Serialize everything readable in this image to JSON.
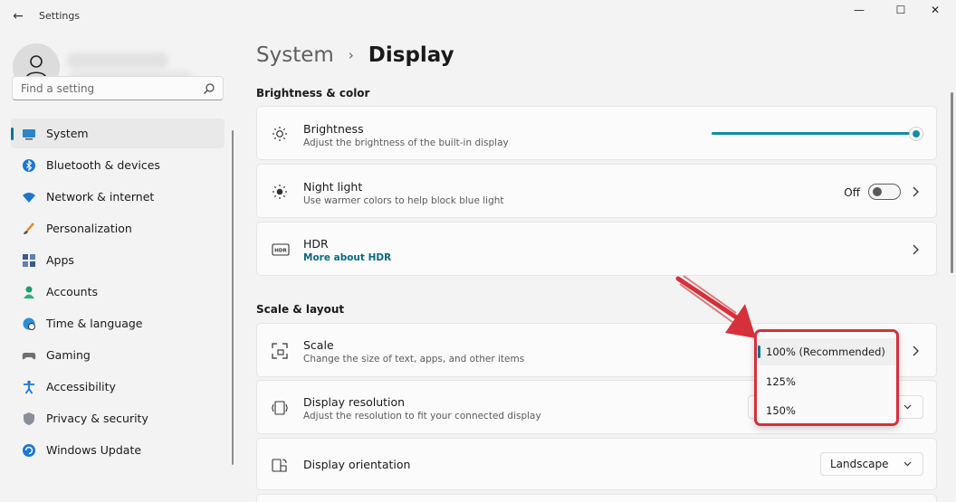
{
  "window": {
    "title": "Settings",
    "back_glyph": "←",
    "minimize_glyph": "—",
    "maximize_glyph": "☐",
    "close_glyph": "✕"
  },
  "sidebar": {
    "search_placeholder": "Find a setting",
    "items": [
      {
        "label": "System",
        "icon": "monitor-icon",
        "active": true
      },
      {
        "label": "Bluetooth & devices",
        "icon": "bluetooth-icon"
      },
      {
        "label": "Network & internet",
        "icon": "wifi-icon"
      },
      {
        "label": "Personalization",
        "icon": "brush-icon"
      },
      {
        "label": "Apps",
        "icon": "apps-icon"
      },
      {
        "label": "Accounts",
        "icon": "person-icon"
      },
      {
        "label": "Time & language",
        "icon": "globe-clock-icon"
      },
      {
        "label": "Gaming",
        "icon": "gamepad-icon"
      },
      {
        "label": "Accessibility",
        "icon": "accessibility-icon"
      },
      {
        "label": "Privacy & security",
        "icon": "shield-icon"
      },
      {
        "label": "Windows Update",
        "icon": "update-icon"
      }
    ]
  },
  "breadcrumb": {
    "parent": "System",
    "separator": "›",
    "current": "Display"
  },
  "sections": {
    "brightness_color": "Brightness & color",
    "scale_layout": "Scale & layout"
  },
  "cards": {
    "brightness": {
      "title": "Brightness",
      "desc": "Adjust the brightness of the built-in display",
      "level": 1.0
    },
    "night_light": {
      "title": "Night light",
      "desc": "Use warmer colors to help block blue light",
      "state": "Off"
    },
    "hdr": {
      "title": "HDR",
      "link": "More about HDR",
      "icon_text": "HDR"
    },
    "scale": {
      "title": "Scale",
      "desc": "Change the size of text, apps, and other items"
    },
    "resolution": {
      "title": "Display resolution",
      "desc": "Adjust the resolution to fit your connected display"
    },
    "orientation": {
      "title": "Display orientation",
      "value": "Landscape"
    }
  },
  "scale_dropdown": {
    "options": [
      "100% (Recommended)",
      "125%",
      "150%"
    ],
    "selected": 0
  },
  "colors": {
    "accent": "#0f8ea5",
    "highlight": "#d6303a"
  }
}
